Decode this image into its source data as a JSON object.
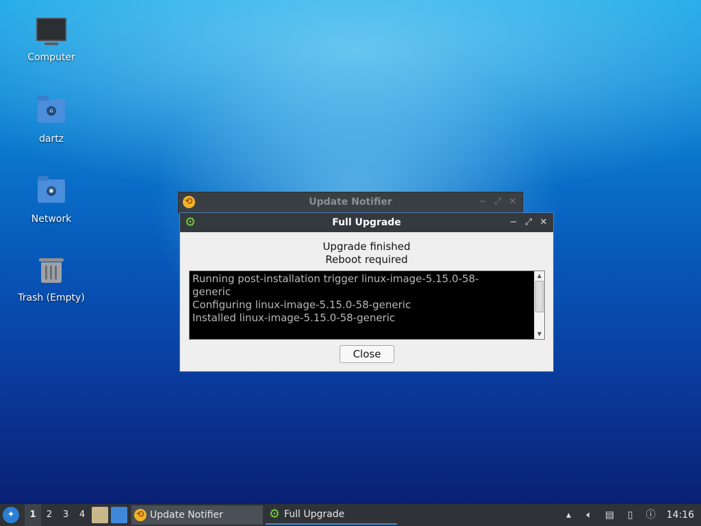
{
  "desktop": {
    "icons": [
      {
        "label": "Computer"
      },
      {
        "label": "dartz"
      },
      {
        "label": "Network"
      },
      {
        "label": "Trash (Empty)"
      }
    ]
  },
  "windows": {
    "notifier": {
      "title": "Update Notifier"
    },
    "upgrade": {
      "title": "Full Upgrade",
      "line1": "Upgrade finished",
      "line2": "Reboot required",
      "log": "Running post-installation trigger linux-image-5.15.0-58-\ngeneric\nConfiguring linux-image-5.15.0-58-generic\nInstalled linux-image-5.15.0-58-generic",
      "close_label": "Close",
      "btn_minimize": "−",
      "btn_maximize": "⤢",
      "btn_close": "✕"
    }
  },
  "taskbar": {
    "workspaces": [
      "1",
      "2",
      "3",
      "4"
    ],
    "active_workspace": "1",
    "tasks": [
      {
        "label": "Update Notifier",
        "icon": "update-icon"
      },
      {
        "label": "Full Upgrade",
        "icon": "gear-icon"
      }
    ],
    "clock": "14:16"
  },
  "colors": {
    "taskbar_bg": "#2f3337",
    "titlebar_bg": "#34393e",
    "window_bg": "#efefef",
    "accent": "#3b8ee6"
  }
}
